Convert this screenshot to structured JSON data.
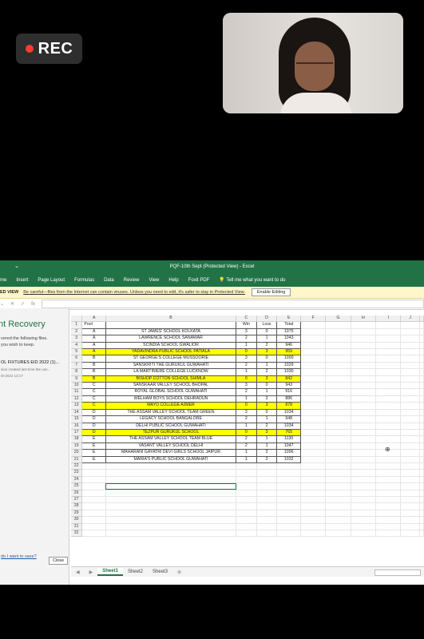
{
  "rec": {
    "label": "REC"
  },
  "excel": {
    "title": "PQF-10th Sept  (Protected View)  -  Excel",
    "menu": [
      "me",
      "Insert",
      "Page Layout",
      "Formulas",
      "Data",
      "Review",
      "View",
      "Help",
      "Foxit PDF"
    ],
    "tell_me": "Tell me what you want to do",
    "protected": {
      "label": "ED VIEW",
      "message": "Be careful—files from the Internet can contain viruses. Unless you need to edit, it's safer to stay in Protected View.",
      "button": "Enable Editing"
    },
    "formula_bar": {
      "fx": "fx",
      "cancel": "✕",
      "confirm": "✓"
    },
    "recovery": {
      "title": "nt Recovery",
      "line1": "vered the following files.",
      "line2": "you wish to keep.",
      "file": "OL FIXTURES EID 2022 (1)...",
      "file_note": "sion created last time the use...",
      "file_date": "/8-2022 13:17",
      "link": "do I want to save?",
      "close": "Close"
    },
    "columns": [
      "A",
      "B",
      "C",
      "D",
      "E",
      "F",
      "G",
      "H",
      "I",
      "J"
    ],
    "header_row": {
      "pool": "Pool",
      "name": "",
      "win": "Win",
      "loss": "Loss",
      "total": "Total"
    },
    "rows": [
      {
        "pool": "A",
        "name": "ST JAMES' SCHOOL KOLKATA",
        "win": "3",
        "loss": "0",
        "total": "1075",
        "hl": false
      },
      {
        "pool": "A",
        "name": "LAWRENCE SCHOOL SANAWAR",
        "win": "2",
        "loss": "1",
        "total": "1043",
        "hl": false
      },
      {
        "pool": "A",
        "name": "SCINDIA SCHOOL GWALIOR",
        "win": "1",
        "loss": "2",
        "total": "946",
        "hl": false
      },
      {
        "pool": "A",
        "name": "YADAVINDRA PUBLIC SCHOOL PATIALA",
        "win": "0",
        "loss": "3",
        "total": "959",
        "hl": true
      },
      {
        "pool": "B",
        "name": "ST GEORGE'S COLLEGE MUSSOORIE",
        "win": "3",
        "loss": "0",
        "total": "1000",
        "hl": false
      },
      {
        "pool": "B",
        "name": "SANSKRITI THE GURUKUL GUWAHATI",
        "win": "2",
        "loss": "1",
        "total": "1029",
        "hl": false
      },
      {
        "pool": "B",
        "name": "LA MARTINIERE COLLEGE LUCKNOW",
        "win": "1",
        "loss": "2",
        "total": "1030",
        "hl": false
      },
      {
        "pool": "B",
        "name": "BISHOP COTTON SCHOOL SHIMLA",
        "win": "0",
        "loss": "3",
        "total": "842",
        "hl": true
      },
      {
        "pool": "C",
        "name": "SANSKAAR VALLEY SCHOOL BHOPAL",
        "win": "3",
        "loss": "0",
        "total": "943",
        "hl": false
      },
      {
        "pool": "C",
        "name": "ROYAL GLOBAL SCHOOL GUWAHATI",
        "win": "2",
        "loss": "1",
        "total": "916",
        "hl": false
      },
      {
        "pool": "C",
        "name": "WELHAM BOYS SCHOOL DEHRADUN",
        "win": "1",
        "loss": "2",
        "total": "886",
        "hl": false
      },
      {
        "pool": "C",
        "name": "MAYO COLLEGE AJMER",
        "win": "0",
        "loss": "3",
        "total": "878",
        "hl": true
      },
      {
        "pool": "D",
        "name": "THE ASSAM VALLEY SCHOOL TEAM GREEN",
        "win": "3",
        "loss": "0",
        "total": "1034",
        "hl": false
      },
      {
        "pool": "D",
        "name": "LEGACY SCHOOL BANGALORE",
        "win": "2",
        "loss": "1",
        "total": "948",
        "hl": false
      },
      {
        "pool": "D",
        "name": "DELHI PUBLIC SCHOOL GUWAHATI",
        "win": "1",
        "loss": "2",
        "total": "1034",
        "hl": false
      },
      {
        "pool": "D",
        "name": "TEZPUR GURUKUL SCHOOL",
        "win": "0",
        "loss": "3",
        "total": "765",
        "hl": true
      },
      {
        "pool": "E",
        "name": "THE ASSAM VALLEY SCHOOL TEAM BLUE",
        "win": "2",
        "loss": "1",
        "total": "1130",
        "hl": false
      },
      {
        "pool": "E",
        "name": "VASANT VALLEY SCHOOL DELHI",
        "win": "2",
        "loss": "1",
        "total": "1047",
        "hl": false
      },
      {
        "pool": "E",
        "name": "MAHARANI GAYATRI DEVI GIRLS SCHOOL JAIPUR",
        "win": "1",
        "loss": "2",
        "total": "1096",
        "hl": false
      },
      {
        "pool": "E",
        "name": "MARIA'S PUBLIC SCHOOL GUWAHATI",
        "win": "1",
        "loss": "2",
        "total": "1032",
        "hl": false
      }
    ],
    "empty_rows": [
      "22",
      "23",
      "24",
      "25",
      "26",
      "27",
      "28",
      "29",
      "30",
      "31",
      "32"
    ],
    "sheet_tabs": [
      "Sheet1",
      "Sheet2",
      "Sheet3"
    ],
    "active_sheet": "Sheet1",
    "selected_cell": "B25"
  },
  "colors": {
    "excel_green": "#217346",
    "highlight": "#ffff00",
    "rec_dot": "#ff3b30"
  }
}
